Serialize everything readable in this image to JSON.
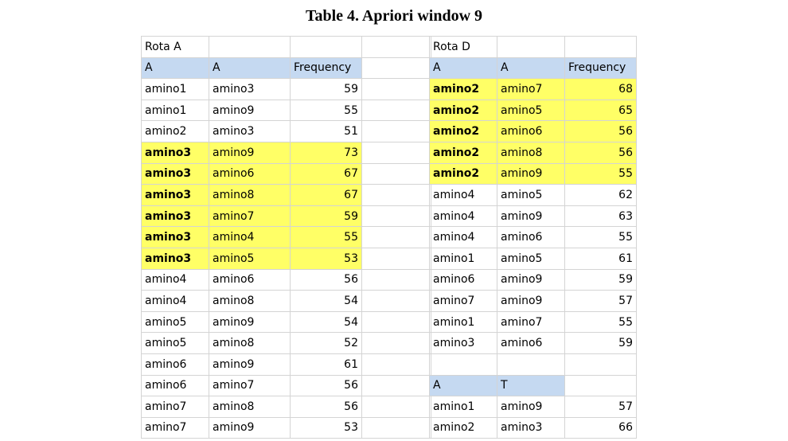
{
  "title": "Table 4. Apriori window 9",
  "left_table": {
    "label": "Rota A",
    "headers": [
      "A",
      "A",
      "Frequency"
    ],
    "rows": [
      {
        "c1": "amino1",
        "c2": "amino3",
        "freq": "59",
        "highlight": false
      },
      {
        "c1": "amino1",
        "c2": "amino9",
        "freq": "55",
        "highlight": false
      },
      {
        "c1": "amino2",
        "c2": "amino3",
        "freq": "51",
        "highlight": false
      },
      {
        "c1": "amino3",
        "c2": "amino9",
        "freq": "73",
        "highlight": true
      },
      {
        "c1": "amino3",
        "c2": "amino6",
        "freq": "67",
        "highlight": true
      },
      {
        "c1": "amino3",
        "c2": "amino8",
        "freq": "67",
        "highlight": true
      },
      {
        "c1": "amino3",
        "c2": "amino7",
        "freq": "59",
        "highlight": true
      },
      {
        "c1": "amino3",
        "c2": "amino4",
        "freq": "55",
        "highlight": true
      },
      {
        "c1": "amino3",
        "c2": "amino5",
        "freq": "53",
        "highlight": true
      },
      {
        "c1": "amino4",
        "c2": "amino6",
        "freq": "56",
        "highlight": false
      },
      {
        "c1": "amino4",
        "c2": "amino8",
        "freq": "54",
        "highlight": false
      },
      {
        "c1": "amino5",
        "c2": "amino9",
        "freq": "54",
        "highlight": false
      },
      {
        "c1": "amino5",
        "c2": "amino8",
        "freq": "52",
        "highlight": false
      },
      {
        "c1": "amino6",
        "c2": "amino9",
        "freq": "61",
        "highlight": false
      },
      {
        "c1": "amino6",
        "c2": "amino7",
        "freq": "56",
        "highlight": false
      },
      {
        "c1": "amino7",
        "c2": "amino8",
        "freq": "56",
        "highlight": false
      },
      {
        "c1": "amino7",
        "c2": "amino9",
        "freq": "53",
        "highlight": false
      }
    ]
  },
  "right_table": {
    "label": "Rota D",
    "headers": [
      "A",
      "A",
      "Frequency"
    ],
    "rows": [
      {
        "c1": "amino2",
        "c2": "amino7",
        "freq": "68",
        "highlight": true
      },
      {
        "c1": "amino2",
        "c2": "amino5",
        "freq": "65",
        "highlight": true
      },
      {
        "c1": "amino2",
        "c2": "amino6",
        "freq": "56",
        "highlight": true
      },
      {
        "c1": "amino2",
        "c2": "amino8",
        "freq": "56",
        "highlight": true
      },
      {
        "c1": "amino2",
        "c2": "amino9",
        "freq": "55",
        "highlight": true
      },
      {
        "c1": "amino4",
        "c2": "amino5",
        "freq": "62",
        "highlight": false
      },
      {
        "c1": "amino4",
        "c2": "amino9",
        "freq": "63",
        "highlight": false
      },
      {
        "c1": "amino4",
        "c2": "amino6",
        "freq": "55",
        "highlight": false
      },
      {
        "c1": "amino1",
        "c2": "amino5",
        "freq": "61",
        "highlight": false
      },
      {
        "c1": "amino6",
        "c2": "amino9",
        "freq": "59",
        "highlight": false
      },
      {
        "c1": "amino7",
        "c2": "amino9",
        "freq": "57",
        "highlight": false
      },
      {
        "c1": "amino1",
        "c2": "amino7",
        "freq": "55",
        "highlight": false
      },
      {
        "c1": "amino3",
        "c2": "amino6",
        "freq": "59",
        "highlight": false
      }
    ],
    "sub_headers": [
      "A",
      "T"
    ],
    "sub_rows": [
      {
        "c1": "amino1",
        "c2": "amino9",
        "freq": "57"
      },
      {
        "c1": "amino2",
        "c2": "amino3",
        "freq": "66"
      }
    ]
  },
  "colors": {
    "header_fill": "#c5d9f1",
    "highlight_fill": "#ffff66",
    "gridline": "#d4d4d4"
  }
}
